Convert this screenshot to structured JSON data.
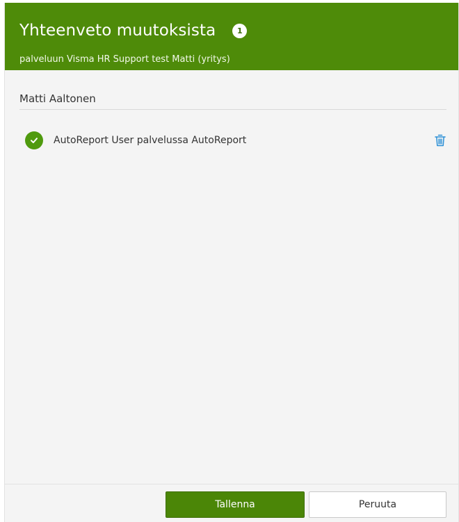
{
  "header": {
    "title": "Yhteenveto muutoksista",
    "count": "1",
    "subtitle": "palveluun Visma HR Support test Matti (yritys)"
  },
  "person": {
    "name": "Matti Aaltonen"
  },
  "changes": [
    {
      "label": "AutoReport User palvelussa AutoReport",
      "status_icon": "check-circle-icon",
      "action_icon": "trash-icon"
    }
  ],
  "footer": {
    "save_label": "Tallenna",
    "cancel_label": "Peruuta"
  },
  "colors": {
    "header_bg": "#4e8b09",
    "primary_button": "#4b8607",
    "check_green": "#4f9a0e",
    "delete_blue": "#2a8fd6"
  }
}
